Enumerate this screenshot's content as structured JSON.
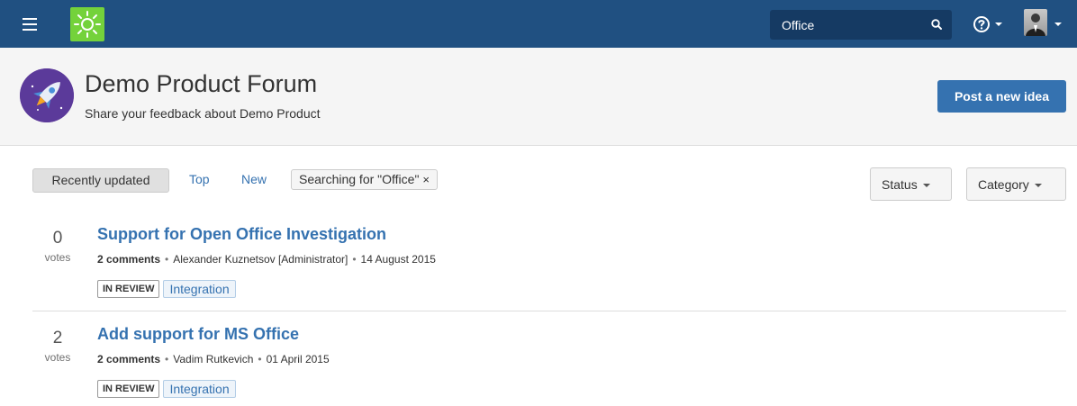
{
  "navbar": {
    "search_value": "Office",
    "colors": {
      "bar": "#205081",
      "logo": "#74d23b"
    }
  },
  "header": {
    "title": "Demo Product Forum",
    "subtitle": "Share your feedback about Demo Product",
    "post_button_label": "Post a new idea"
  },
  "filters": {
    "recently_updated": "Recently updated",
    "top": "Top",
    "new": "New",
    "search_chip": "Searching for \"Office\"",
    "chip_close": "×",
    "status": "Status",
    "category": "Category"
  },
  "ideas": [
    {
      "votes": "0",
      "votes_label": "votes",
      "title": "Support for Open Office Investigation",
      "comments": "2 comments",
      "author": "Alexander Kuznetsov [Administrator]",
      "date": "14 August 2015",
      "status": "IN REVIEW",
      "category": "Integration"
    },
    {
      "votes": "2",
      "votes_label": "votes",
      "title": "Add support for MS Office",
      "comments": "2 comments",
      "author": "Vadim Rutkevich",
      "date": "01 April 2015",
      "status": "IN REVIEW",
      "category": "Integration"
    }
  ],
  "meta_separator": "•",
  "icons": {
    "menu": "hamburger-menu-icon",
    "logo": "lightbulb-logo-icon",
    "search": "search-icon",
    "help": "help-icon",
    "forum": "rocket-icon"
  }
}
